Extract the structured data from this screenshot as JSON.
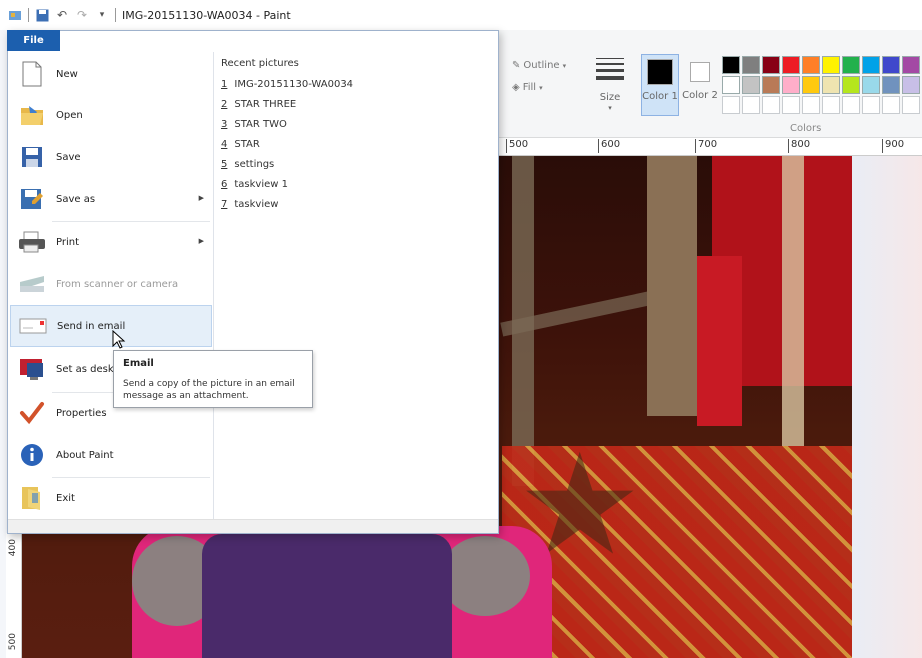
{
  "window": {
    "title": "IMG-20151130-WA0034 - Paint"
  },
  "file_menu": {
    "tab_label": "File",
    "items": [
      {
        "label": "New",
        "icon": "new-document-icon"
      },
      {
        "label": "Open",
        "icon": "open-folder-icon"
      },
      {
        "label": "Save",
        "icon": "save-disk-icon"
      },
      {
        "label": "Save as",
        "icon": "save-as-icon"
      },
      {
        "label": "Print",
        "icon": "printer-icon"
      },
      {
        "label": "From scanner or camera",
        "icon": "scanner-icon"
      },
      {
        "label": "Send in email",
        "icon": "email-icon"
      },
      {
        "label": "Set as deskto",
        "icon": "desktop-background-icon"
      },
      {
        "label": "Properties",
        "icon": "checkmark-icon"
      },
      {
        "label": "About Paint",
        "icon": "info-icon"
      },
      {
        "label": "Exit",
        "icon": "exit-icon"
      }
    ],
    "recent_title": "Recent pictures",
    "recent": [
      {
        "num": "1",
        "name": "IMG-20151130-WA0034"
      },
      {
        "num": "2",
        "name": "STAR THREE"
      },
      {
        "num": "3",
        "name": "STAR TWO"
      },
      {
        "num": "4",
        "name": "STAR"
      },
      {
        "num": "5",
        "name": "settings"
      },
      {
        "num": "6",
        "name": "taskview 1"
      },
      {
        "num": "7",
        "name": "taskview"
      }
    ]
  },
  "tooltip": {
    "title": "Email",
    "text": "Send a copy of the picture in an email message as an attachment."
  },
  "ribbon": {
    "outline_label": "Outline",
    "fill_label": "Fill",
    "size_label": "Size",
    "color1_label": "Color 1",
    "color2_label": "Color 2",
    "colors_label": "Colors",
    "color1_value": "#000000",
    "color2_value": "#ffffff",
    "palette": [
      "#000000",
      "#7f7f7f",
      "#880015",
      "#ed1c24",
      "#ff7f27",
      "#fff200",
      "#22b14c",
      "#00a2e8",
      "#3f48cc",
      "#a349a4",
      "#ffffff",
      "#c3c3c3",
      "#b97a57",
      "#ffaec9",
      "#ffc90e",
      "#efe4b0",
      "#b5e61d",
      "#99d9ea",
      "#7092be",
      "#c8bfe7"
    ]
  },
  "ruler": {
    "h_ticks": [
      "500",
      "600",
      "700",
      "800",
      "900"
    ],
    "v_ticks": [
      "400",
      "500"
    ]
  }
}
